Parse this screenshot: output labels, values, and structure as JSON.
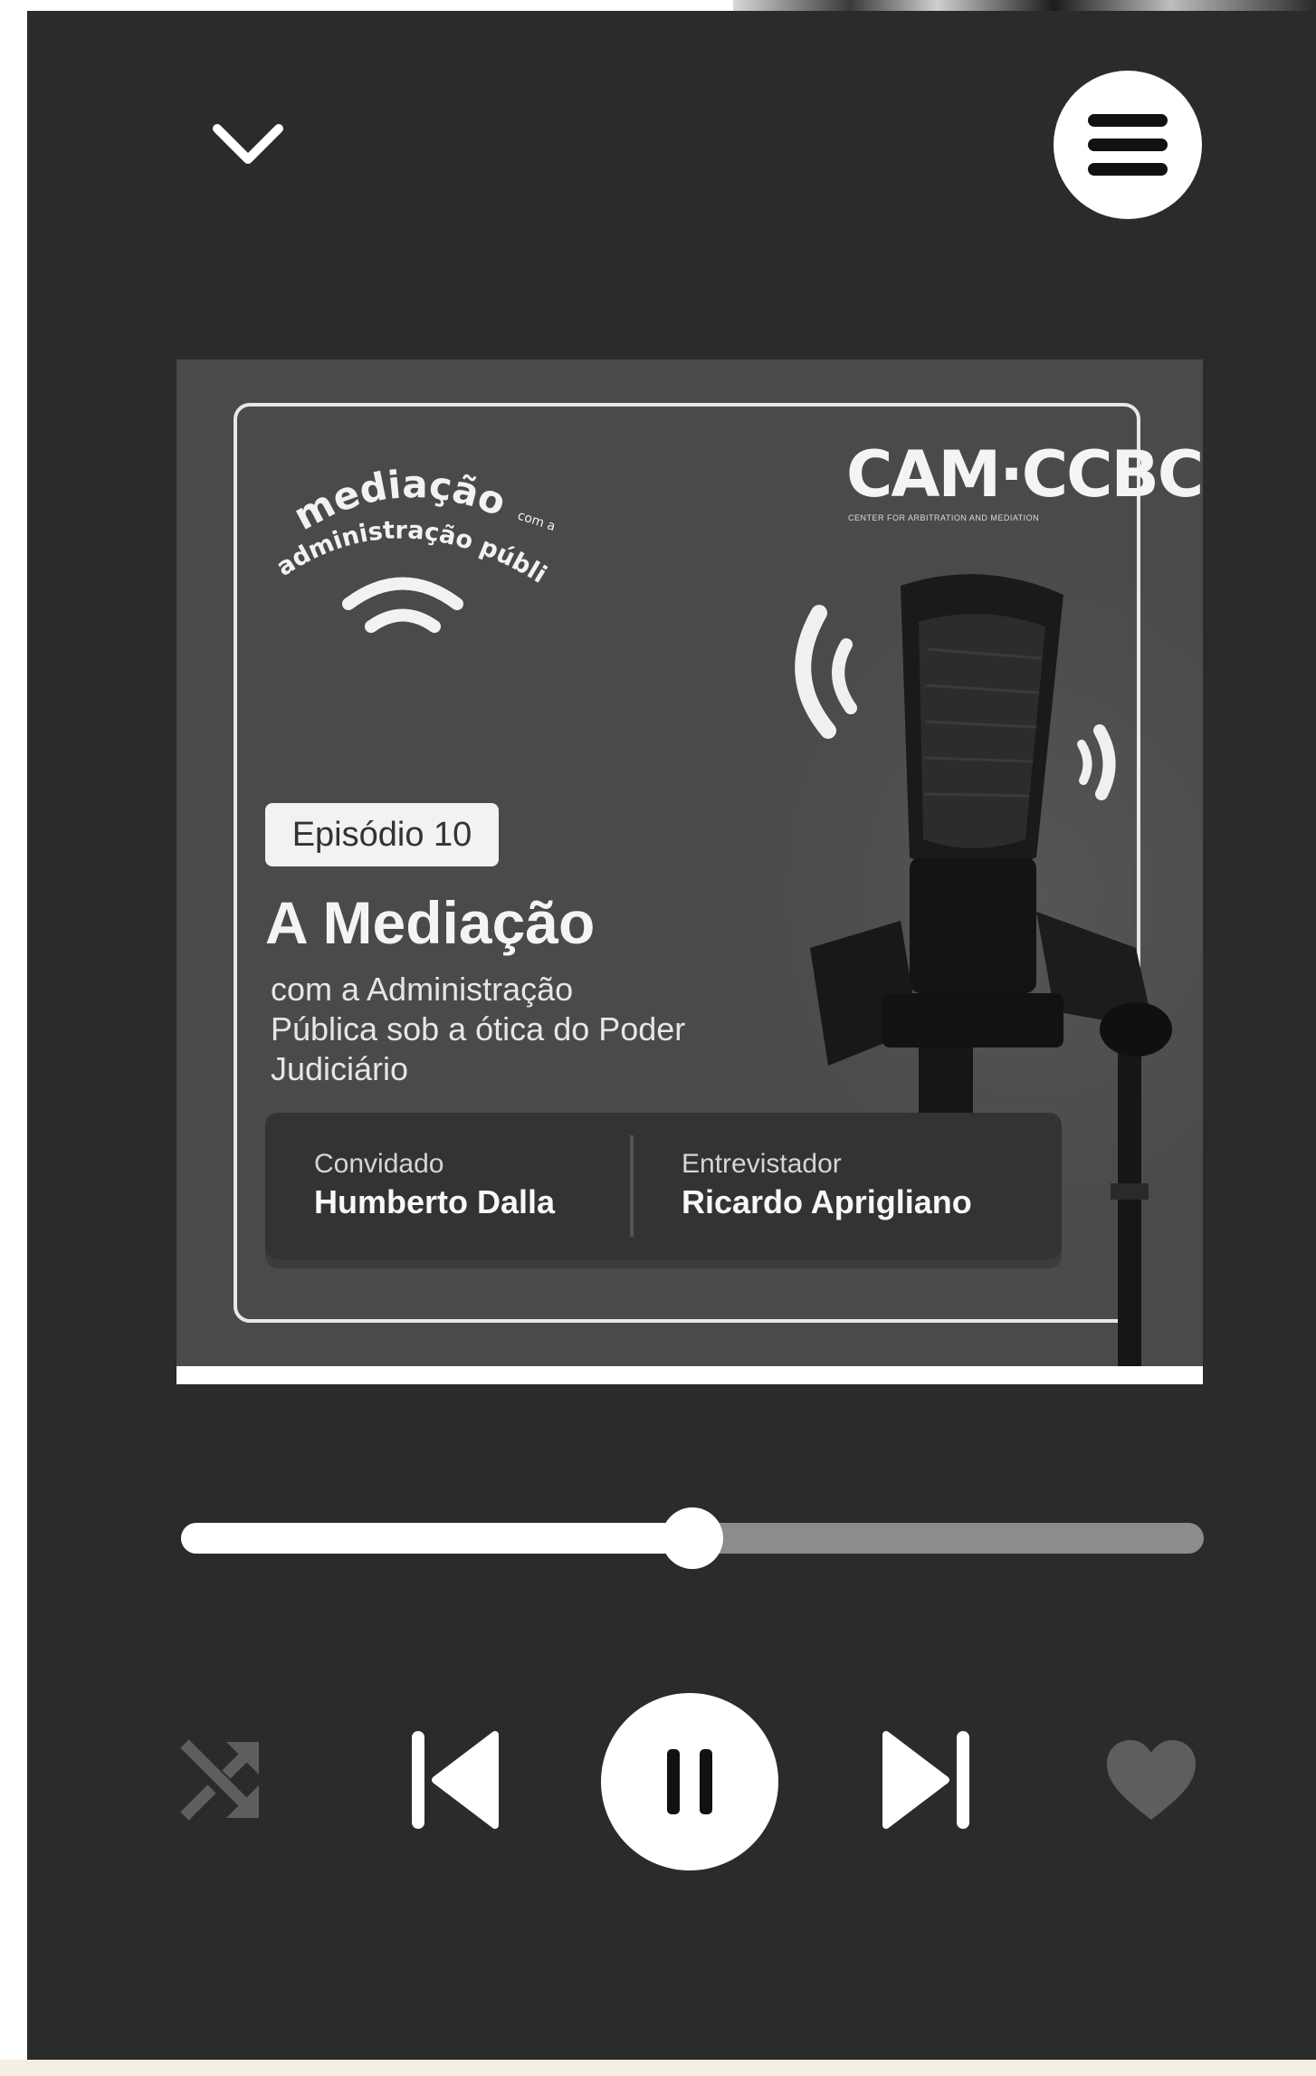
{
  "header": {
    "collapse_icon": "chevron-down-icon",
    "menu_icon": "hamburger-menu-icon"
  },
  "artwork": {
    "series_logo": {
      "line1": "mediação",
      "line1_small": "com a",
      "line2": "administração pública",
      "icon": "broadcast-waves-icon"
    },
    "brand_logo": {
      "main": "CAM·CCBC",
      "subtitle": "CENTER FOR ARBITRATION AND MEDIATION"
    },
    "episode_badge": "Episódio 10",
    "title": "A Mediação",
    "subtitle": "com a Administração Pública sob a ótica do Poder Judiciário",
    "guest_label": "Convidado",
    "guest_name": "Humberto Dalla",
    "interviewer_label": "Entrevistador",
    "interviewer_name": "Ricardo Aprigliano",
    "image_icon": "microphone-icon"
  },
  "playback": {
    "progress": 0.5,
    "is_playing": true
  },
  "controls": {
    "shuffle_icon": "shuffle-icon",
    "shuffle_active": false,
    "previous_icon": "skip-previous-icon",
    "play_pause_icon": "pause-icon",
    "next_icon": "skip-next-icon",
    "like_icon": "heart-icon",
    "liked": false
  },
  "colors": {
    "background": "#2b2b2b",
    "foreground": "#ffffff",
    "track": "#8c8c8c",
    "inactive_icon": "#5e5e5e"
  }
}
